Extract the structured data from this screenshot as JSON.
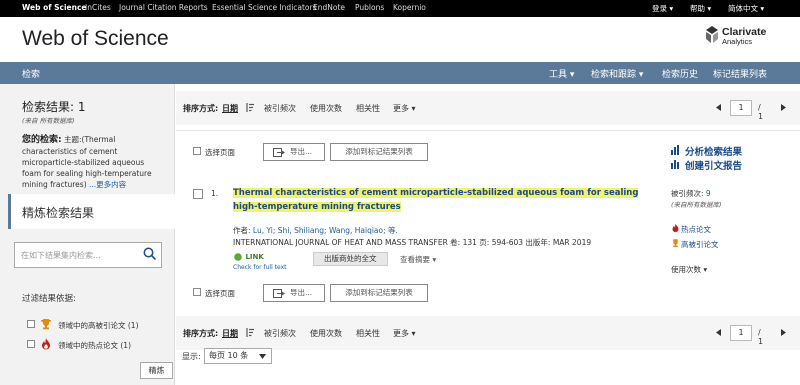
{
  "topbar": {
    "links": [
      "Web of Science",
      "InCites",
      "Journal Citation Reports",
      "Essential Science Indicators",
      "EndNote",
      "Publons",
      "Kopernio"
    ],
    "right": [
      "登录 ▾",
      "帮助 ▾",
      "简体中文 ▾"
    ]
  },
  "header": {
    "logo": "Web of Science",
    "brand": "Clarivate",
    "brand_sub": "Analytics"
  },
  "navbar": {
    "left": "检索",
    "right": [
      "工具 ▾",
      "检索和跟踪 ▾",
      "检索历史",
      "标记结果列表"
    ]
  },
  "left": {
    "results_label": "检索结果: 1",
    "results_sub": "(来自 所有数据库)",
    "query_label": "您的检索:",
    "query_field": "主题:",
    "query_text": "(Thermal characteristics of cement microparticle-stabilized aqueous foam for sealing high-temperature mining fractures)",
    "more": "...更多内容",
    "refine_title": "精炼检索结果",
    "search_placeholder": "在如下结果集内检索...",
    "filter_title": "过滤结果依据:",
    "filters": [
      "领域中的高被引论文 (1)",
      "领域中的热点论文 (1)"
    ],
    "refine_button": "精炼"
  },
  "sort": {
    "label": "排序方式:",
    "options": [
      "日期",
      "被引频次",
      "使用次数",
      "相关性",
      "更多 ▾"
    ],
    "page": "1",
    "of": "/ 1"
  },
  "actions": {
    "select_page": "选择页面",
    "export": "导出...",
    "add_marked": "添加到标记结果列表"
  },
  "record": {
    "number": "1.",
    "title": "Thermal characteristics of cement microparticle-stabilized aqueous foam for sealing high-temperature mining fractures",
    "authors_label": "作者:",
    "authors": "Lu, Yi; Shi, Shiliang; Wang, Haiqiao; 等.",
    "source": "INTERNATIONAL JOURNAL OF HEAT AND MASS TRANSFER  卷: 131  页: 594-603  出版年: MAR 2019",
    "link_logo": "LINK",
    "link_sub": "Check for full text",
    "full_text": "出版商处的全文",
    "abstract": "查看摘要 ▾"
  },
  "right": {
    "analyze": "分析检索结果",
    "citation_report": "创建引文报告",
    "times_cited_label": "被引频次:",
    "times_cited_value": "9",
    "times_cited_sub": "(来自所有数据库)",
    "hot_paper": "热点论文",
    "highly_cited": "高被引论文",
    "usage": "使用次数 ▾"
  },
  "bottom": {
    "display_label": "显示:",
    "per_page": "每页 10 条"
  },
  "colors": {
    "navbar": "#5b7a9a",
    "highlight": "#f4f26a",
    "link": "#1a4a8a"
  }
}
